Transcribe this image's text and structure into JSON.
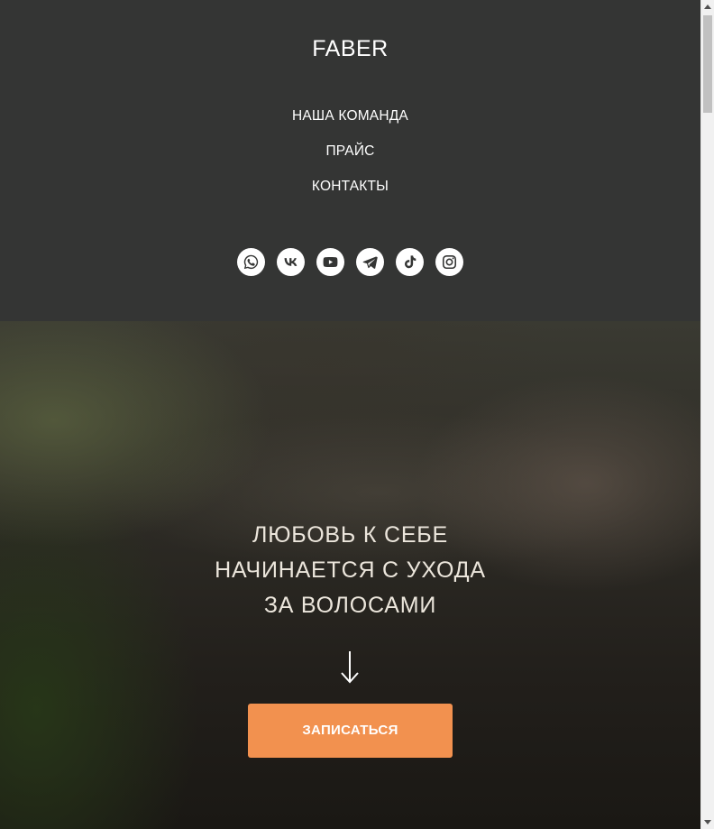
{
  "header": {
    "logo": "FABER",
    "background_color": "#343534",
    "nav": [
      {
        "label": "НАША КОМАНДА"
      },
      {
        "label": "ПРАЙС"
      },
      {
        "label": "КОНТАКТЫ"
      }
    ],
    "socials": [
      "whatsapp-icon",
      "vk-icon",
      "youtube-icon",
      "telegram-icon",
      "tiktok-icon",
      "instagram-icon"
    ]
  },
  "hero": {
    "title_lines": [
      "ЛЮБОВЬ К СЕБЕ",
      "НАЧИНАЕТСЯ С УХОДА",
      "ЗА ВОЛОСАМИ"
    ],
    "arrow_icon": "arrow-down-icon",
    "cta_label": "ЗАПИСАТЬСЯ",
    "cta_color": "#f2914f"
  }
}
